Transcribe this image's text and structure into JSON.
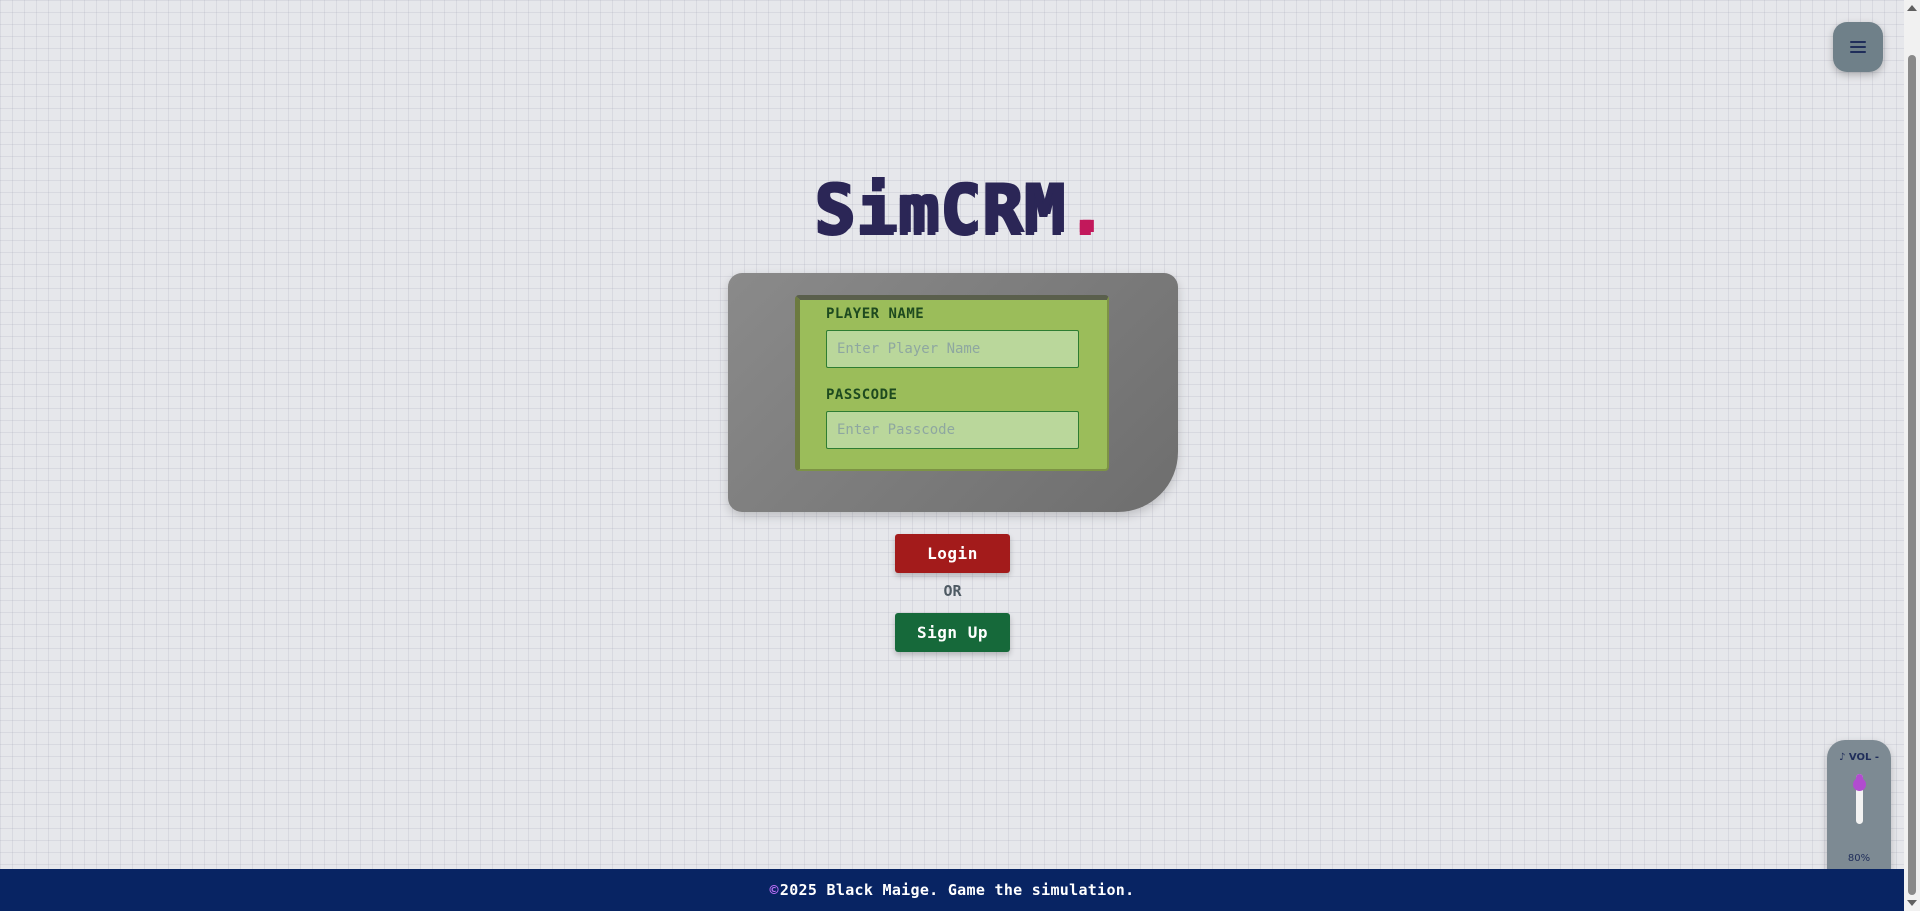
{
  "app": {
    "logo_text": "SimCRM",
    "logo_dot": "."
  },
  "menu": {
    "icon": "hamburger-menu-icon"
  },
  "login_form": {
    "player_name_label": "PLAYER NAME",
    "player_name_placeholder": "Enter Player Name",
    "player_name_value": "",
    "passcode_label": "PASSCODE",
    "passcode_placeholder": "Enter Passcode",
    "passcode_value": ""
  },
  "actions": {
    "login_label": "Login",
    "or_label": "OR",
    "signup_label": "Sign Up"
  },
  "volume": {
    "label": "♪ VOL -",
    "level": 0.8,
    "percent_text": "80%",
    "prev_symbol": "‹",
    "pause_symbol": "⏸",
    "next_symbol": "›"
  },
  "footer": {
    "copyright_symbol": "©",
    "text": "2025 Black Maige. Game the simulation."
  },
  "colors": {
    "background": "#e6e7eb",
    "logo": "#2b2656",
    "logo_accent": "#c2185b",
    "device_shell": "#7a7a7a",
    "screen": "#9bbd5a",
    "login_button": "#a31b1b",
    "signup_button": "#16693a",
    "footer": "#082463",
    "volume_accent": "#b14ccf"
  }
}
